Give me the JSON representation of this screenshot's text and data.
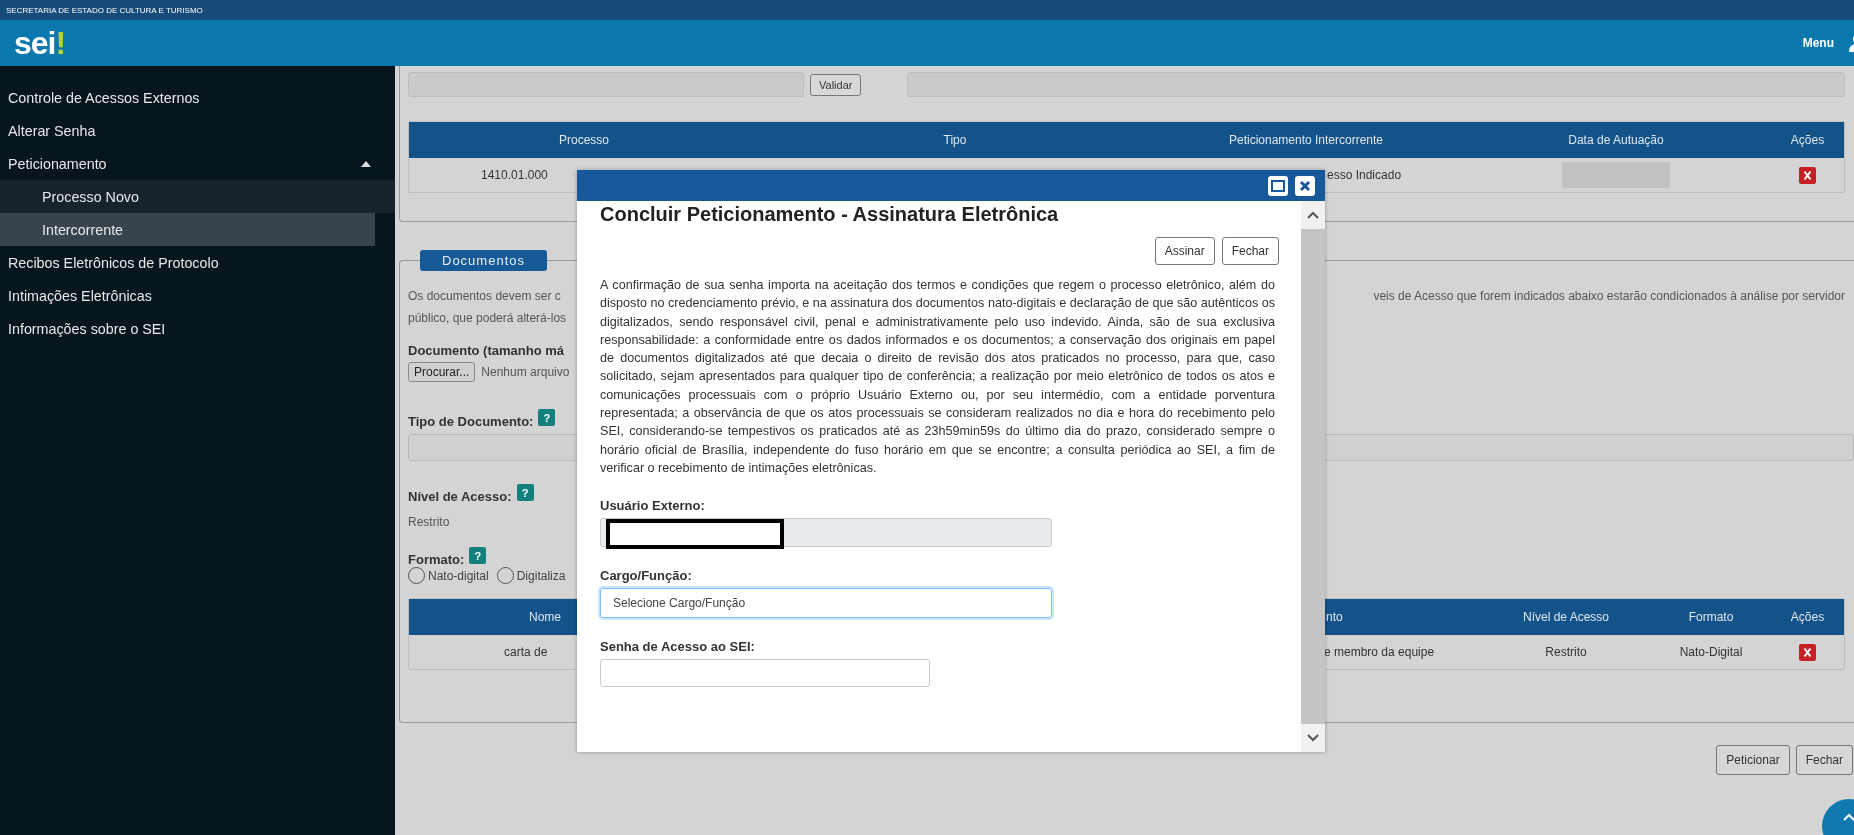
{
  "header": {
    "organization": "SECRETARIA DE ESTADO DE CULTURA E TURISMO",
    "logo": "sei",
    "logo_mark": "!",
    "menu": "Menu"
  },
  "sidebar": {
    "items": [
      {
        "label": "Controle de Acessos Externos",
        "selected": false
      },
      {
        "label": "Alterar Senha",
        "selected": false
      },
      {
        "label": "Peticionamento",
        "selected": false,
        "expanded": true,
        "children": [
          {
            "label": "Processo Novo",
            "selected": false
          },
          {
            "label": "Intercorrente",
            "selected": true
          }
        ]
      },
      {
        "label": "Recibos Eletrônicos de Protocolo",
        "selected": false
      },
      {
        "label": "Intimações Eletrônicas",
        "selected": false
      },
      {
        "label": "Informações sobre o SEI",
        "selected": false
      }
    ]
  },
  "process_section": {
    "validate_button": "Validar",
    "table": {
      "columns": [
        "Processo",
        "Tipo",
        "Peticionamento Intercorrente",
        "Data de Autuação",
        "Ações"
      ],
      "rows": [
        {
          "processo": "1410.01.000",
          "peticionamento": "esso Indicado"
        }
      ]
    }
  },
  "documents_section": {
    "legend": "Documentos",
    "intro_left": [
      "Os documentos devem ser c",
      "público, que poderá alterá-los"
    ],
    "intro_right": "veis de Acesso que forem indicados abaixo estarão condicionados à análise por servidor",
    "document_label": "Documento (tamanho má",
    "browse_button": "Procurar...",
    "no_file": "Nenhum arquivo",
    "type_label": "Tipo de Documento:",
    "type_help": "?",
    "access_label": "Nível de Acesso:",
    "access_help": "?",
    "access_value": "Restrito",
    "format_label": "Formato:",
    "format_help": "?",
    "format_options": [
      {
        "label": "Nato-digital",
        "selected": false
      },
      {
        "label": "Digitaliza",
        "selected": false
      }
    ],
    "table": {
      "columns": [
        "Nome",
        "nto",
        "Nível de Acesso",
        "Formato",
        "Ações"
      ],
      "rows": [
        {
          "nome": "carta de",
          "documento": "e membro da equipe",
          "nivel": "Restrito",
          "formato": "Nato-Digital"
        }
      ]
    }
  },
  "actions": [
    "Peticionar",
    "Fechar"
  ],
  "modal": {
    "title": "Concluir Peticionamento - Assinatura Eletrônica",
    "buttons": [
      "Assinar",
      "Fechar"
    ],
    "text": "A confirmação de sua senha importa na aceitação dos termos e condições que regem o processo eletrônico, além do disposto no credenciamento prévio, e na assinatura dos documentos nato-digitais e declaração de que são autênticos os digitalizados, sendo responsável civil, penal e administrativamente pelo uso indevido. Ainda, são de sua exclusiva responsabilidade: a conformidade entre os dados informados e os documentos; a conservação dos originais em papel de documentos digitalizados até que decaia o direito de revisão dos atos praticados no processo, para que, caso solicitado, sejam apresentados para qualquer tipo de conferência; a realização por meio eletrônico de todos os atos e comunicações processuais com o próprio Usuário Externo ou, por seu intermédio, com a entidade porventura representada; a observância de que os atos processuais se consideram realizados no dia e hora do recebimento pelo SEI, considerando-se tempestivos os praticados até as 23h59min59s do último dia do prazo, considerado sempre o horário oficial de Brasília, independente do fuso horário em que se encontre; a consulta periódica ao SEI, a fim de verificar o recebimento de intimações eletrônicas.",
    "user_label": "Usuário Externo:",
    "user_disabled": true,
    "role_label": "Cargo/Função:",
    "role_value": "Selecione Cargo/Função",
    "role_focused": true,
    "password_label": "Senha de Acesso ao SEI:"
  }
}
